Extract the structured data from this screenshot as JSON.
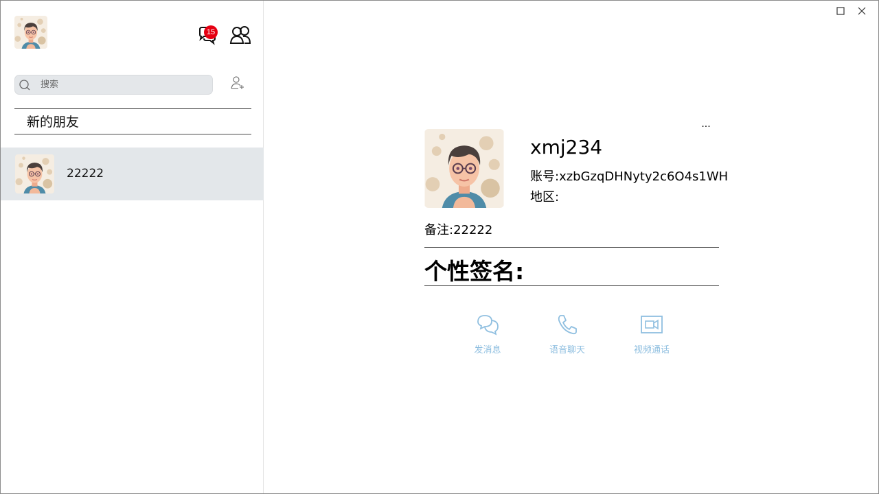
{
  "sidebar": {
    "badge_count": "15",
    "search": {
      "placeholder": "搜索",
      "value": ""
    },
    "new_friends_label": "新的朋友",
    "contacts": [
      {
        "name": "22222"
      }
    ]
  },
  "profile": {
    "nickname": "xmj234",
    "account": "账号:xzbGzqDHNyty2c6O4s1WH",
    "region": "地区:",
    "remark": "备注:22222",
    "signature": "个性签名:",
    "more_label": "...",
    "actions": {
      "message": "发消息",
      "voice": "语音聊天",
      "video": "视频通话"
    }
  },
  "colors": {
    "badge": "#e60012",
    "selected_row": "#e3e7ea",
    "search_bg": "#e4e7ea",
    "action_accent": "#8fbfe0"
  },
  "icons": [
    "chat-bubble-icon",
    "contacts-icon",
    "search-icon",
    "add-friend-icon",
    "maximize-icon",
    "close-icon",
    "message-icon",
    "phone-icon",
    "video-icon"
  ]
}
